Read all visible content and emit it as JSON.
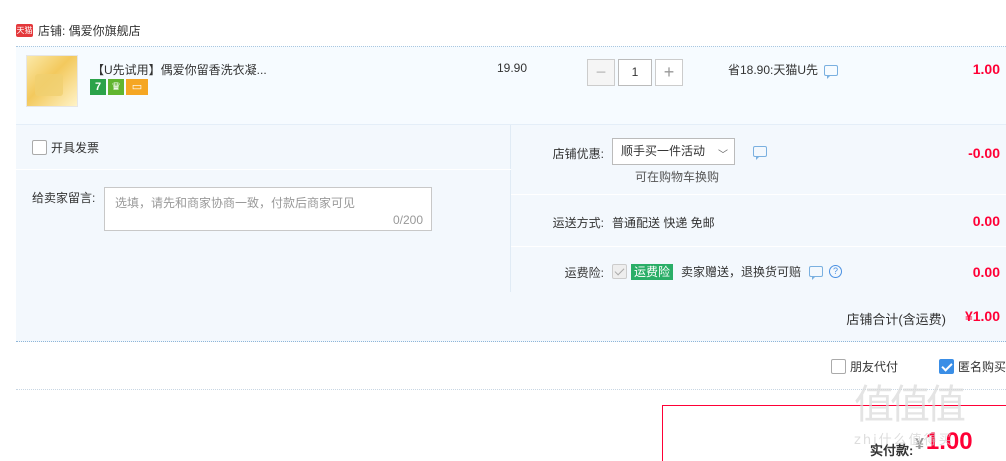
{
  "store": {
    "logo_text": "天猫",
    "name_label": "店铺: 偶爱你旗舰店"
  },
  "item": {
    "title": "【U先试用】偶爱你留香洗衣凝...",
    "badges": [
      "7",
      "",
      ""
    ],
    "price": "19.90",
    "qty_minus": "−",
    "quantity": "1",
    "qty_plus": "+",
    "savings": "省18.90:天猫U先",
    "line_total": "1.00"
  },
  "invoice": {
    "label": "开具发票"
  },
  "message": {
    "label": "给卖家留言:",
    "placeholder": "选填，请先和商家协商一致，付款后商家可见",
    "counter": "0/200"
  },
  "promo": {
    "label": "店铺优惠:",
    "selected": "顺手买一件活动",
    "sub": "可在购物车换购",
    "amount": "-0.00"
  },
  "shipping": {
    "label": "运送方式:",
    "value": "普通配送 快递 免邮",
    "amount": "0.00"
  },
  "insurance": {
    "label": "运费险:",
    "tag": "运费险",
    "desc": "卖家赠送，退换货可赔",
    "amount": "0.00"
  },
  "subtotal": {
    "label": "店铺合计(含运费)",
    "amount": "¥1.00"
  },
  "pay_options": {
    "friend_pay": "朋友代付",
    "anonymous": "匿名购买"
  },
  "final": {
    "label": "实付款:",
    "symbol": "¥",
    "amount": "1.00"
  },
  "watermark": {
    "text": "值值值",
    "url": "zhi什么值得买"
  },
  "colors": {
    "accent": "#ff0036",
    "panel": "#f3f8fd",
    "ins_tag": "#2aae67"
  }
}
